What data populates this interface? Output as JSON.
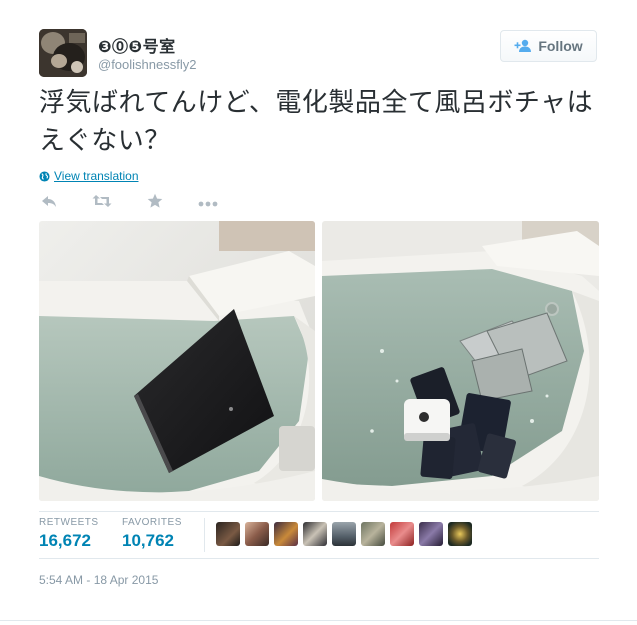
{
  "user": {
    "display_name": "❸⓪❺号室",
    "handle": "@foolishnessfly2"
  },
  "follow_button": {
    "label": "Follow"
  },
  "tweet": {
    "text": "浮気ばれてんけど、電化製品全て風呂ボチャはえぐない？",
    "translate_label": "View translation"
  },
  "actions": [
    {
      "icon": "reply-icon"
    },
    {
      "icon": "retweet-icon"
    },
    {
      "icon": "favorite-star-icon"
    },
    {
      "icon": "more-icon"
    }
  ],
  "stats": {
    "retweets_label": "RETWEETS",
    "retweets_count": "16,672",
    "favorites_label": "FAVORITES",
    "favorites_count": "10,762"
  },
  "timestamp": "5:54 AM - 18 Apr 2015",
  "colors": {
    "link": "#0084b4",
    "muted": "#8899a6",
    "text": "#292f33",
    "border": "#e1e8ed"
  }
}
